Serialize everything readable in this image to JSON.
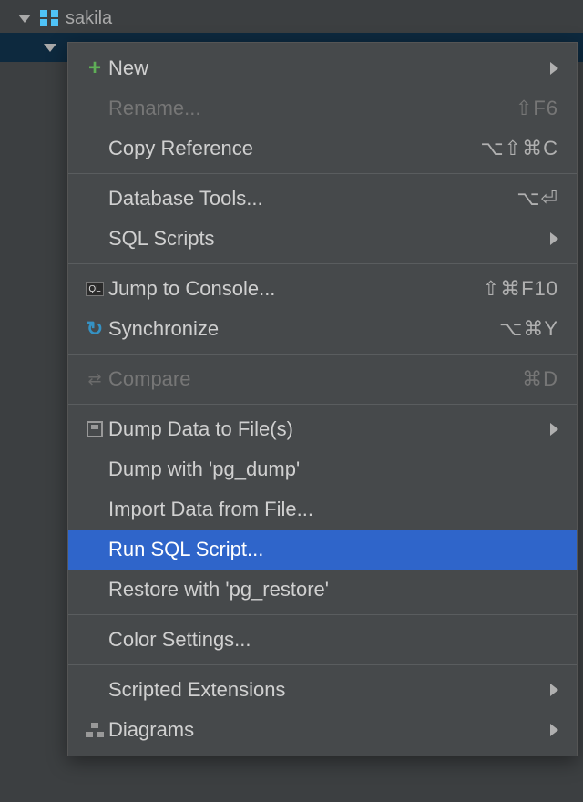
{
  "tree": {
    "root_label": "sakila"
  },
  "menu": [
    {
      "kind": "item",
      "id": "new",
      "label": "New",
      "icon": "plus",
      "submenu": true
    },
    {
      "kind": "item",
      "id": "rename",
      "label": "Rename...",
      "shortcut": "⇧F6",
      "disabled": true
    },
    {
      "kind": "item",
      "id": "copy-ref",
      "label": "Copy Reference",
      "shortcut": "⌥⇧⌘C"
    },
    {
      "kind": "sep"
    },
    {
      "kind": "item",
      "id": "db-tools",
      "label": "Database Tools...",
      "shortcut": "⌥⏎"
    },
    {
      "kind": "item",
      "id": "sql-scripts",
      "label": "SQL Scripts",
      "submenu": true
    },
    {
      "kind": "sep"
    },
    {
      "kind": "item",
      "id": "jump-console",
      "label": "Jump to Console...",
      "icon": "console",
      "shortcut": "⇧⌘F10"
    },
    {
      "kind": "item",
      "id": "synchronize",
      "label": "Synchronize",
      "icon": "sync",
      "shortcut": "⌥⌘Y"
    },
    {
      "kind": "sep"
    },
    {
      "kind": "item",
      "id": "compare",
      "label": "Compare",
      "icon": "compare",
      "shortcut": "⌘D",
      "disabled": true
    },
    {
      "kind": "sep"
    },
    {
      "kind": "item",
      "id": "dump-files",
      "label": "Dump Data to File(s)",
      "icon": "save",
      "submenu": true
    },
    {
      "kind": "item",
      "id": "dump-pg",
      "label": "Dump with 'pg_dump'"
    },
    {
      "kind": "item",
      "id": "import-file",
      "label": "Import Data from File..."
    },
    {
      "kind": "item",
      "id": "run-sql",
      "label": "Run SQL Script...",
      "highlighted": true
    },
    {
      "kind": "item",
      "id": "restore-pg",
      "label": "Restore with 'pg_restore'"
    },
    {
      "kind": "sep"
    },
    {
      "kind": "item",
      "id": "color-settings",
      "label": "Color Settings..."
    },
    {
      "kind": "sep"
    },
    {
      "kind": "item",
      "id": "scripted-ext",
      "label": "Scripted Extensions",
      "submenu": true
    },
    {
      "kind": "item",
      "id": "diagrams",
      "label": "Diagrams",
      "icon": "diagram",
      "submenu": true
    }
  ]
}
